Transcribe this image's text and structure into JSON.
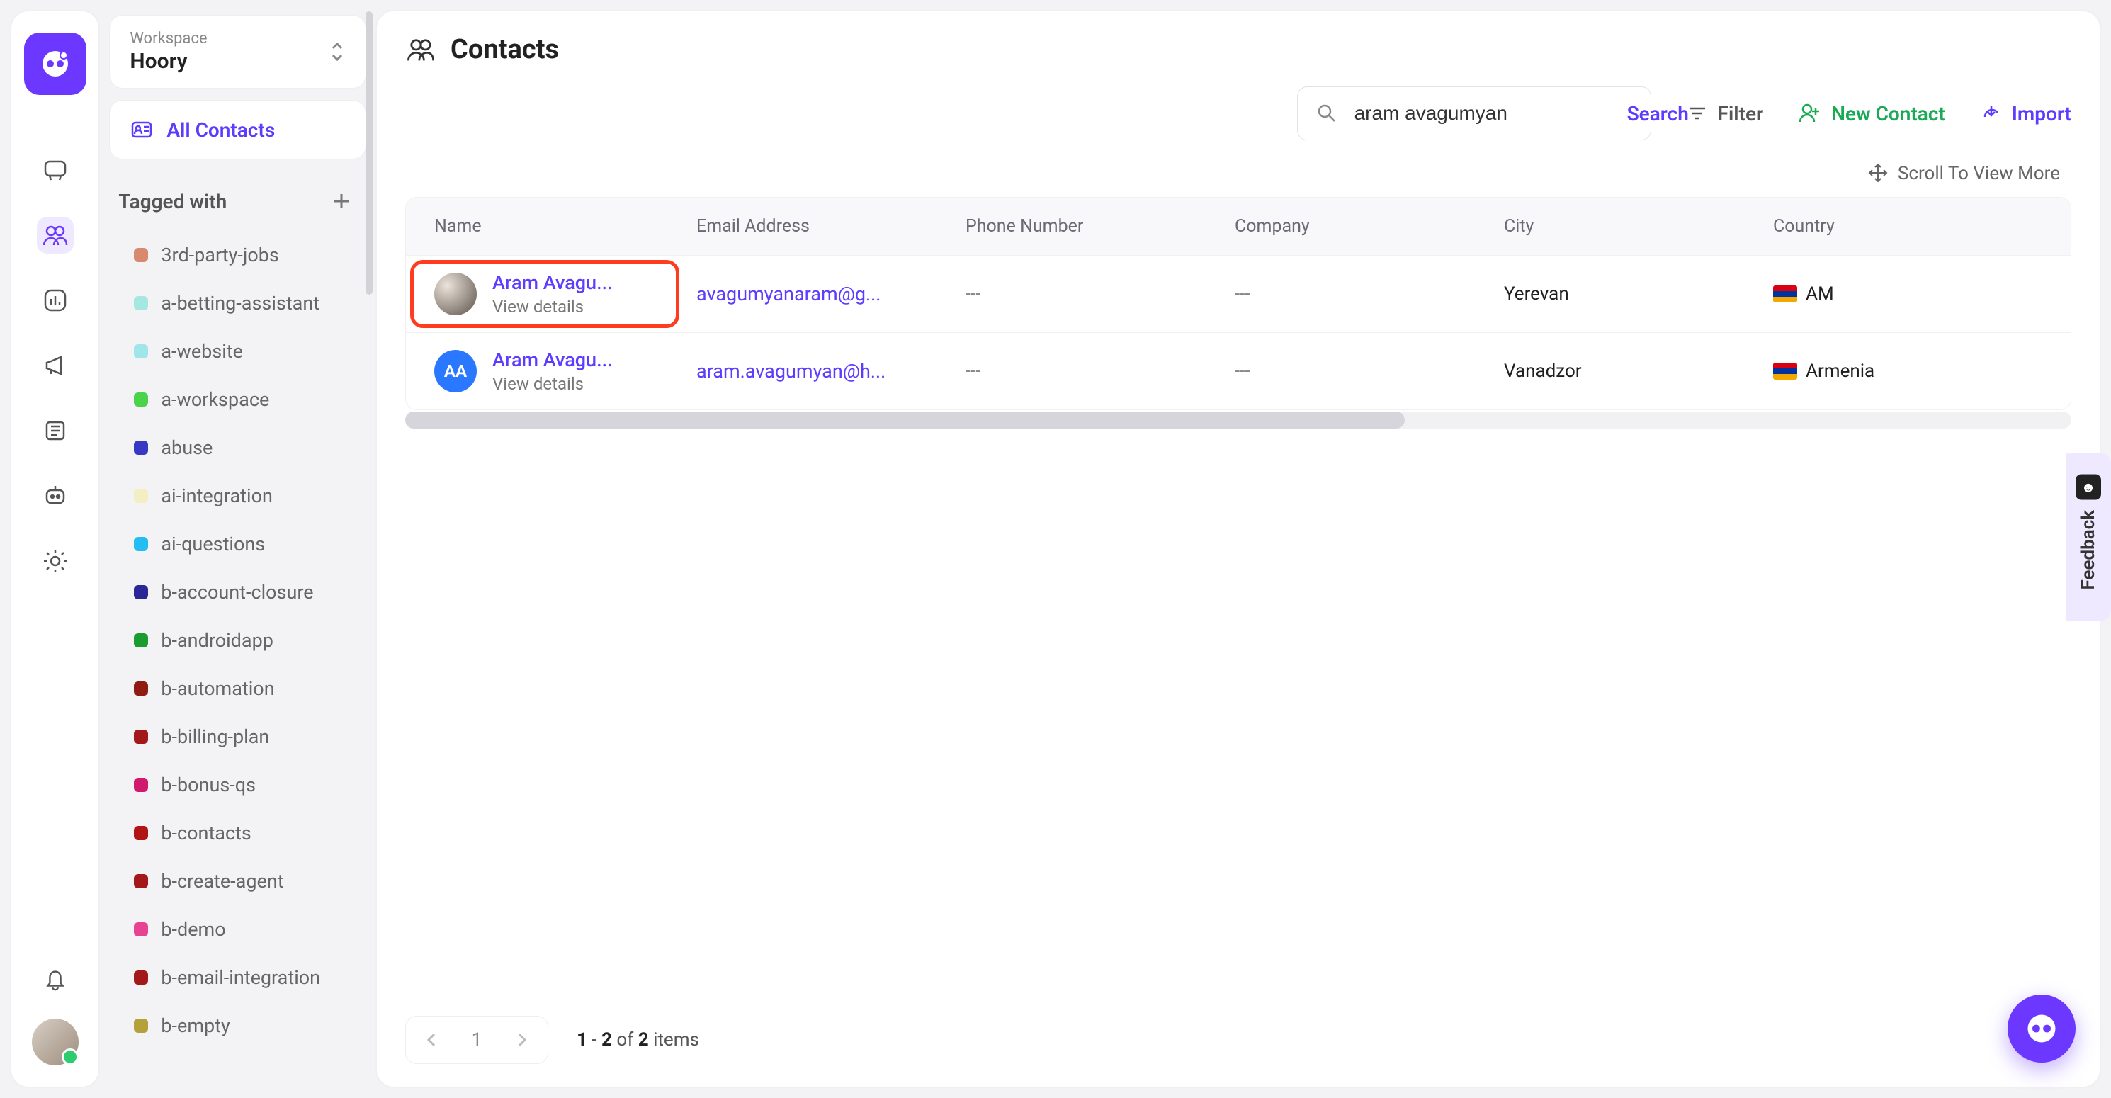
{
  "workspace": {
    "label": "Workspace",
    "name": "Hoory"
  },
  "sidebar": {
    "all_contacts": "All Contacts",
    "tagged_label": "Tagged with",
    "tags": [
      {
        "label": "3rd-party-jobs",
        "color": "#d88a6f"
      },
      {
        "label": "a-betting-assistant",
        "color": "#a7e7e2"
      },
      {
        "label": "a-website",
        "color": "#9fe5ea"
      },
      {
        "label": "a-workspace",
        "color": "#4bd44b"
      },
      {
        "label": "abuse",
        "color": "#3839c2"
      },
      {
        "label": "ai-integration",
        "color": "#f5eec2"
      },
      {
        "label": "ai-questions",
        "color": "#22bdf2"
      },
      {
        "label": "b-account-closure",
        "color": "#2a2797"
      },
      {
        "label": "b-androidapp",
        "color": "#1a9c2e"
      },
      {
        "label": "b-automation",
        "color": "#8f1b13"
      },
      {
        "label": "b-billing-plan",
        "color": "#a31818"
      },
      {
        "label": "b-bonus-qs",
        "color": "#d11a6b"
      },
      {
        "label": "b-contacts",
        "color": "#b01414"
      },
      {
        "label": "b-create-agent",
        "color": "#a31818"
      },
      {
        "label": "b-demo",
        "color": "#e84393"
      },
      {
        "label": "b-email-integration",
        "color": "#a31818"
      },
      {
        "label": "b-empty",
        "color": "#b5a13a"
      }
    ]
  },
  "page": {
    "title": "Contacts"
  },
  "search": {
    "value": "aram avagumyan",
    "button": "Search"
  },
  "toolbar": {
    "filter": "Filter",
    "new_contact": "New Contact",
    "import": "Import"
  },
  "scroll_hint": "Scroll To View More",
  "table": {
    "headers": {
      "name": "Name",
      "email": "Email Address",
      "phone": "Phone Number",
      "company": "Company",
      "city": "City",
      "country": "Country"
    },
    "view_details": "View details",
    "rows": [
      {
        "name": "Aram Avagu...",
        "email": "avagumyanaram@g...",
        "phone": "---",
        "company": "---",
        "city": "Yerevan",
        "country": "AM",
        "avatar_type": "photo",
        "initials": "",
        "highlight": true
      },
      {
        "name": "Aram Avagu...",
        "email": "aram.avagumyan@h...",
        "phone": "---",
        "company": "---",
        "city": "Vanadzor",
        "country": "Armenia",
        "avatar_type": "initials",
        "initials": "AA",
        "highlight": false
      }
    ]
  },
  "pagination": {
    "page": "1",
    "range_start": "1",
    "range_end": "2",
    "total": "2",
    "items_label": "items",
    "of_label": "of"
  },
  "feedback": {
    "label": "Feedback"
  }
}
